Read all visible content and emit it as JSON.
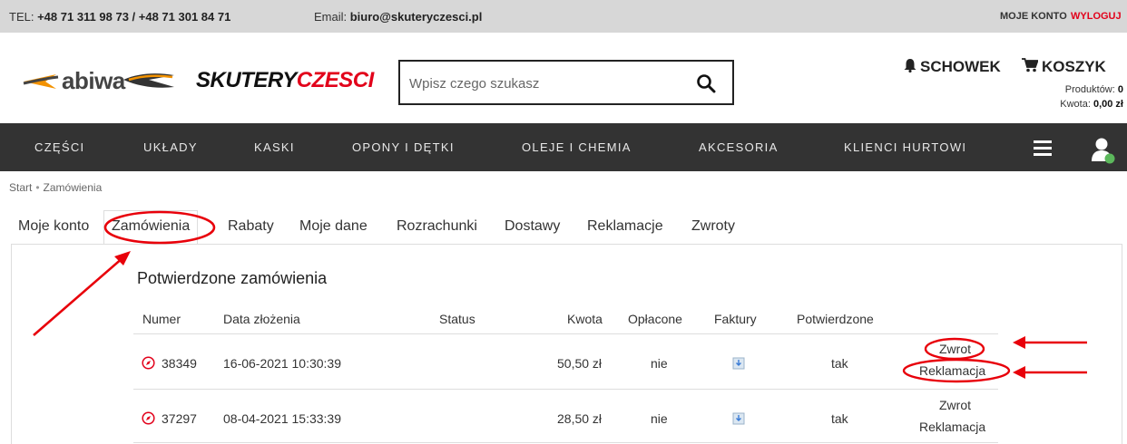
{
  "topbar": {
    "phone_prefix": "TEL: ",
    "phone": "+48 71 311 98 73 / +48 71 301 84 71",
    "email_prefix": "Email: ",
    "email": "biuro@skuteryczesci.pl",
    "account": "MOJE KONTO",
    "logout": "WYLOGUJ"
  },
  "header": {
    "logo_abiwa": "abiwa",
    "logo_sk_black": "SKUTERY",
    "logo_sk_red": "CZESCI",
    "search_placeholder": "Wpisz czego szukasz",
    "schowek": "SCHOWEK",
    "koszyk": "KOSZYK",
    "products_label": "Produktów: ",
    "products_value": "0",
    "amount_label": "Kwota: ",
    "amount_value": "0,00 zł"
  },
  "nav": {
    "items": [
      "CZĘŚCI",
      "UKŁADY",
      "KASKI",
      "OPONY I DĘTKI",
      "OLEJE I CHEMIA",
      "AKCESORIA",
      "KLIENCI HURTOWI"
    ]
  },
  "breadcrumb": [
    "Start",
    "Zamówienia"
  ],
  "tabs": [
    "Moje konto",
    "Zamówienia",
    "Rabaty",
    "Moje dane",
    "Rozrachunki",
    "Dostawy",
    "Reklamacje",
    "Zwroty"
  ],
  "orders": {
    "title": "Potwierdzone zamówienia",
    "headers": [
      "Numer",
      "Data złożenia",
      "Status",
      "Kwota",
      "Opłacone",
      "Faktury",
      "Potwierdzone"
    ],
    "rows": [
      {
        "number": "38349",
        "date": "16-06-2021 10:30:39",
        "status": "",
        "amount": "50,50 zł",
        "paid": "nie",
        "confirmed": "tak",
        "return": "Zwrot",
        "complaint": "Reklamacja"
      },
      {
        "number": "37297",
        "date": "08-04-2021 15:33:39",
        "status": "",
        "amount": "28,50 zł",
        "paid": "nie",
        "confirmed": "tak",
        "return": "Zwrot",
        "complaint": "Reklamacja"
      }
    ]
  },
  "colors": {
    "accent_red": "#e2001a",
    "nav_bg": "#333333",
    "topbar_bg": "#d7d7d7",
    "annotation_red": "#e8000a"
  }
}
